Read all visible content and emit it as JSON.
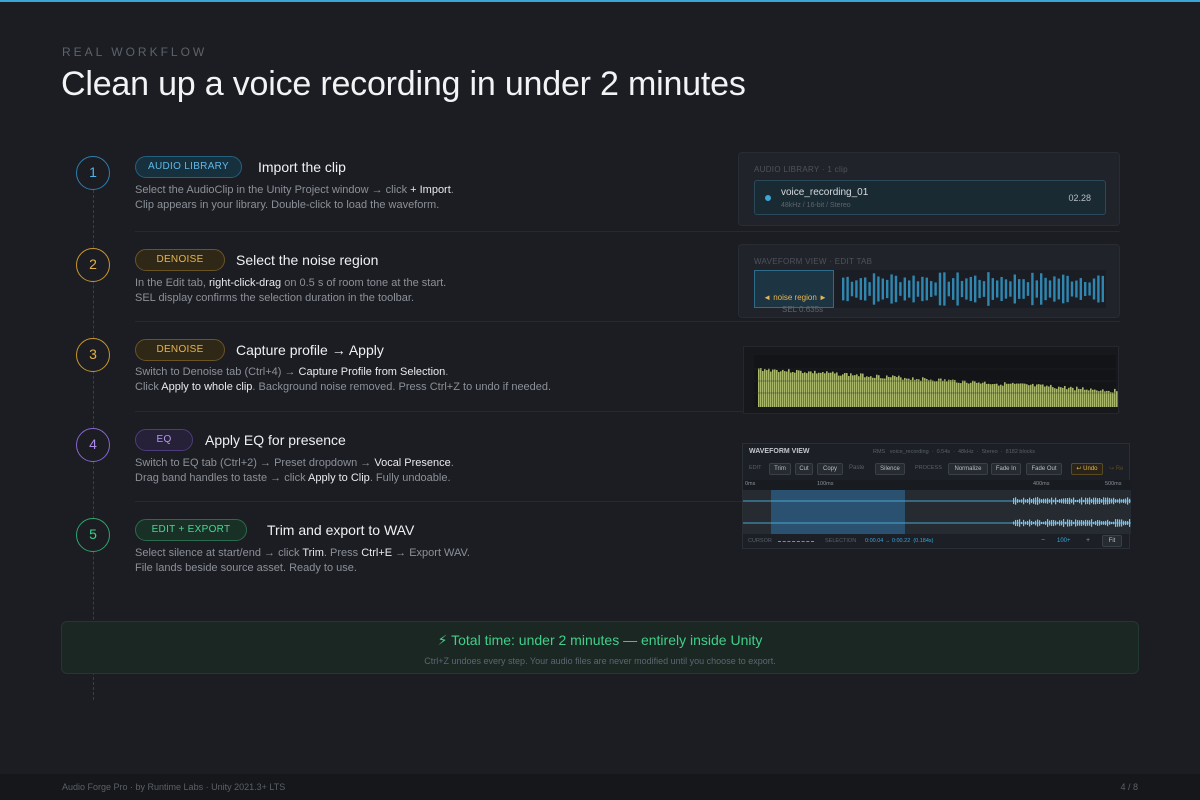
{
  "header": {
    "eyebrow": "REAL WORKFLOW",
    "title": "Clean up a voice recording in under 2 minutes"
  },
  "steps": [
    {
      "number": "1",
      "tag": "AUDIO LIBRARY",
      "title": "Import the clip",
      "lines": [
        [
          "Select the AudioClip in the Unity Project window → click ",
          {
            "b": "+ Import"
          },
          "."
        ],
        [
          "Clip appears in your library. Double-click to load the waveform."
        ]
      ]
    },
    {
      "number": "2",
      "tag": "DENOISE",
      "title": "Select the noise region",
      "lines": [
        [
          "In the Edit tab, ",
          {
            "b": "right-click-drag"
          },
          " on 0.5 s of room tone at the start."
        ],
        [
          "SEL display confirms the selection duration in the toolbar."
        ]
      ]
    },
    {
      "number": "3",
      "tag": "DENOISE",
      "title": "Capture profile → Apply",
      "lines": [
        [
          "Switch to Denoise tab (Ctrl+4) → ",
          {
            "b": "Capture Profile from Selection"
          },
          "."
        ],
        [
          "Click ",
          {
            "b": "Apply to whole clip"
          },
          ". Background noise removed. Press Ctrl+Z to undo if needed."
        ]
      ]
    },
    {
      "number": "4",
      "tag": "EQ",
      "title": "Apply EQ for presence",
      "lines": [
        [
          "Switch to EQ tab (Ctrl+2) → Preset dropdown → ",
          {
            "b": "Vocal Presence"
          },
          "."
        ],
        [
          "Drag band handles to taste → click ",
          {
            "b": "Apply to Clip"
          },
          ". Fully undoable."
        ]
      ]
    },
    {
      "number": "5",
      "tag": "EDIT + EXPORT",
      "title": "Trim and export to WAV",
      "lines": [
        [
          "Select silence at start/end → click ",
          {
            "b": "Trim"
          },
          ". Press ",
          {
            "b": "Ctrl+E"
          },
          " → Export WAV."
        ],
        [
          "File lands beside source asset. Ready to use."
        ]
      ]
    }
  ],
  "library_panel": {
    "caption": "AUDIO LIBRARY · 1 clip",
    "clip_name": "voice_recording_01",
    "clip_meta": "48kHz / 16-bit / Stereo",
    "clip_length": "02.28"
  },
  "waveform_panel": {
    "caption": "WAVEFORM VIEW · EDIT TAB",
    "selection_label": "◄ noise region ►",
    "selection_readout": "SEL 0.635s"
  },
  "waveform_view": {
    "title": "WAVEFORM VIEW",
    "info": "RMS   voice_recording  ·  0.54s  ·  48kHz  ·  Stereo  ·  8182 blocks",
    "edit_label": "EDIT",
    "edit_buttons": [
      "Trim",
      "Cut",
      "Copy"
    ],
    "paste_label": "Paste",
    "silence_button": "Silence",
    "process_label": "PROCESS",
    "process_buttons": [
      "Normalize",
      "Fade In",
      "Fade Out"
    ],
    "undo_button": "↩ Undo",
    "redo_button": "↪ Re",
    "ruler": [
      "0ms",
      "100ms",
      "400ms",
      "500ms"
    ],
    "cursor_label": "CURSOR",
    "selection_label": "SELECTION",
    "selection_value": "0:00.04 → 0:00.22  (0.184s)",
    "zoom_minus": "−",
    "zoom_value": "100+",
    "zoom_plus": "+",
    "fit_button": "Fit"
  },
  "summary": {
    "title": "⚡ Total time: under 2 minutes — entirely inside Unity",
    "subtitle": "Ctrl+Z undoes every step. Your audio files are never modified until you choose to export."
  },
  "footer": {
    "left": "Audio Forge Pro · by Runtime Labs · Unity 2021.3+ LTS",
    "right": "4 / 8"
  },
  "colors": {
    "accent_blue": "#3aa6d8",
    "amber": "#e4b24a",
    "purple": "#a98be8",
    "green": "#3fd089"
  }
}
